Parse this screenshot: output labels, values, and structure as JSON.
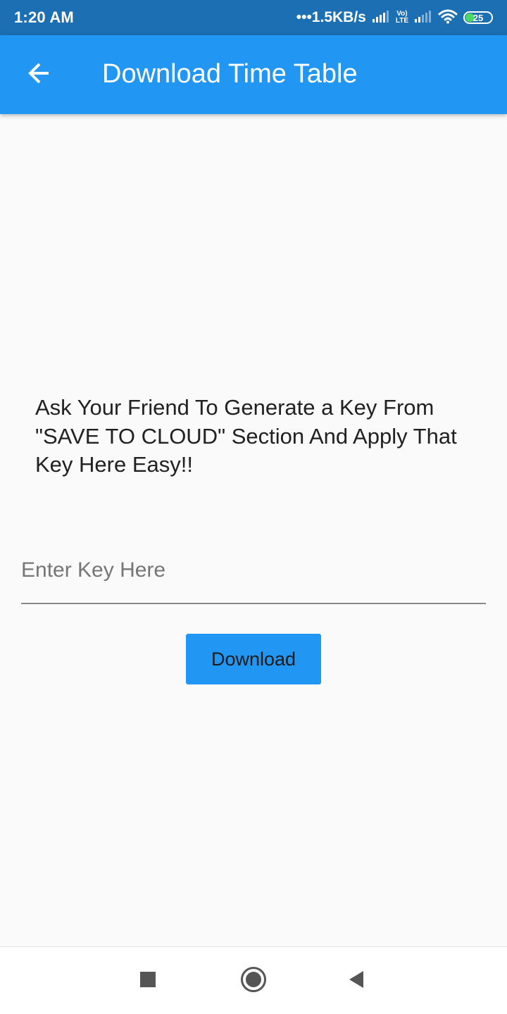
{
  "status_bar": {
    "time": "1:20 AM",
    "net_speed": "•••1.5KB/s",
    "lte_top": "Vo)",
    "lte_bottom": "LTE",
    "battery_level": "25",
    "battery_fraction": 0.25,
    "battery_color": "#4cd964"
  },
  "app_bar": {
    "title": "Download Time Table",
    "back_icon": "arrow-left-icon",
    "color": "#2196f3"
  },
  "main": {
    "instruction": "Ask Your Friend To Generate a Key From \"SAVE TO CLOUD\" Section And Apply That Key Here Easy!!",
    "key_input": {
      "placeholder": "Enter Key Here",
      "value": ""
    },
    "download_label": "Download"
  },
  "nav_bar": {
    "recents_icon": "square-icon",
    "home_icon": "circle-home-icon",
    "back_icon": "triangle-back-icon"
  }
}
